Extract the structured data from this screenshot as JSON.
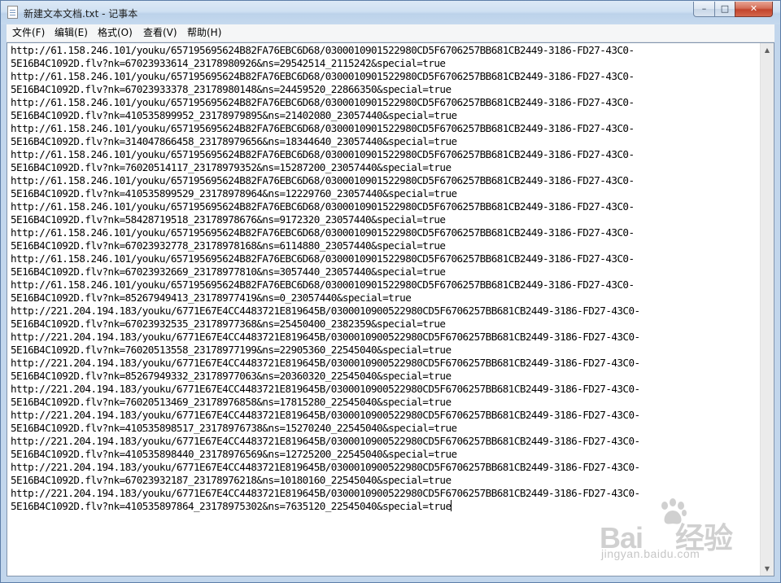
{
  "window": {
    "title": "新建文本文档.txt - 记事本",
    "controls": {
      "minimize": "–",
      "maximize": "□",
      "close": "✕"
    }
  },
  "menu": {
    "items": [
      "文件(F)",
      "编辑(E)",
      "格式(O)",
      "查看(V)",
      "帮助(H)"
    ]
  },
  "editor": {
    "lines": [
      "http://61.158.246.101/youku/657195695624B82FA76EBC6D68/0300010901522980CD5F6706257BB681CB2449-3186-FD27-43C0-",
      "5E16B4C1092D.flv?nk=67023933614_23178980926&ns=29542514_2115242&special=true",
      "http://61.158.246.101/youku/657195695624B82FA76EBC6D68/0300010901522980CD5F6706257BB681CB2449-3186-FD27-43C0-",
      "5E16B4C1092D.flv?nk=67023933378_23178980148&ns=24459520_22866350&special=true",
      "http://61.158.246.101/youku/657195695624B82FA76EBC6D68/0300010901522980CD5F6706257BB681CB2449-3186-FD27-43C0-",
      "5E16B4C1092D.flv?nk=410535899952_23178979895&ns=21402080_23057440&special=true",
      "http://61.158.246.101/youku/657195695624B82FA76EBC6D68/0300010901522980CD5F6706257BB681CB2449-3186-FD27-43C0-",
      "5E16B4C1092D.flv?nk=314047866458_23178979656&ns=18344640_23057440&special=true",
      "http://61.158.246.101/youku/657195695624B82FA76EBC6D68/0300010901522980CD5F6706257BB681CB2449-3186-FD27-43C0-",
      "5E16B4C1092D.flv?nk=76020514117_23178979352&ns=15287200_23057440&special=true",
      "http://61.158.246.101/youku/657195695624B82FA76EBC6D68/0300010901522980CD5F6706257BB681CB2449-3186-FD27-43C0-",
      "5E16B4C1092D.flv?nk=410535899529_23178978964&ns=12229760_23057440&special=true",
      "http://61.158.246.101/youku/657195695624B82FA76EBC6D68/0300010901522980CD5F6706257BB681CB2449-3186-FD27-43C0-",
      "5E16B4C1092D.flv?nk=58428719518_23178978676&ns=9172320_23057440&special=true",
      "http://61.158.246.101/youku/657195695624B82FA76EBC6D68/0300010901522980CD5F6706257BB681CB2449-3186-FD27-43C0-",
      "5E16B4C1092D.flv?nk=67023932778_23178978168&ns=6114880_23057440&special=true",
      "http://61.158.246.101/youku/657195695624B82FA76EBC6D68/0300010901522980CD5F6706257BB681CB2449-3186-FD27-43C0-",
      "5E16B4C1092D.flv?nk=67023932669_23178977810&ns=3057440_23057440&special=true",
      "http://61.158.246.101/youku/657195695624B82FA76EBC6D68/0300010901522980CD5F6706257BB681CB2449-3186-FD27-43C0-",
      "5E16B4C1092D.flv?nk=85267949413_23178977419&ns=0_23057440&special=true",
      "http://221.204.194.183/youku/6771E67E4CC4483721E819645B/0300010900522980CD5F6706257BB681CB2449-3186-FD27-43C0-",
      "5E16B4C1092D.flv?nk=67023932535_23178977368&ns=25450400_2382359&special=true",
      "http://221.204.194.183/youku/6771E67E4CC4483721E819645B/0300010900522980CD5F6706257BB681CB2449-3186-FD27-43C0-",
      "5E16B4C1092D.flv?nk=76020513558_23178977199&ns=22905360_22545040&special=true",
      "http://221.204.194.183/youku/6771E67E4CC4483721E819645B/0300010900522980CD5F6706257BB681CB2449-3186-FD27-43C0-",
      "5E16B4C1092D.flv?nk=85267949332_23178977063&ns=20360320_22545040&special=true",
      "http://221.204.194.183/youku/6771E67E4CC4483721E819645B/0300010900522980CD5F6706257BB681CB2449-3186-FD27-43C0-",
      "5E16B4C1092D.flv?nk=76020513469_23178976858&ns=17815280_22545040&special=true",
      "http://221.204.194.183/youku/6771E67E4CC4483721E819645B/0300010900522980CD5F6706257BB681CB2449-3186-FD27-43C0-",
      "5E16B4C1092D.flv?nk=410535898517_23178976738&ns=15270240_22545040&special=true",
      "http://221.204.194.183/youku/6771E67E4CC4483721E819645B/0300010900522980CD5F6706257BB681CB2449-3186-FD27-43C0-",
      "5E16B4C1092D.flv?nk=410535898440_23178976569&ns=12725200_22545040&special=true",
      "http://221.204.194.183/youku/6771E67E4CC4483721E819645B/0300010900522980CD5F6706257BB681CB2449-3186-FD27-43C0-",
      "5E16B4C1092D.flv?nk=67023932187_23178976218&ns=10180160_22545040&special=true",
      "http://221.204.194.183/youku/6771E67E4CC4483721E819645B/0300010900522980CD5F6706257BB681CB2449-3186-FD27-43C0-",
      "5E16B4C1092D.flv?nk=410535897864_23178975302&ns=7635120_22545040&special=true"
    ]
  },
  "scrollbar": {
    "up": "▲",
    "down": "▼"
  },
  "watermark": {
    "logo_left": "Bai",
    "logo_right": "经验",
    "url": "jingyan.baidu.com"
  }
}
